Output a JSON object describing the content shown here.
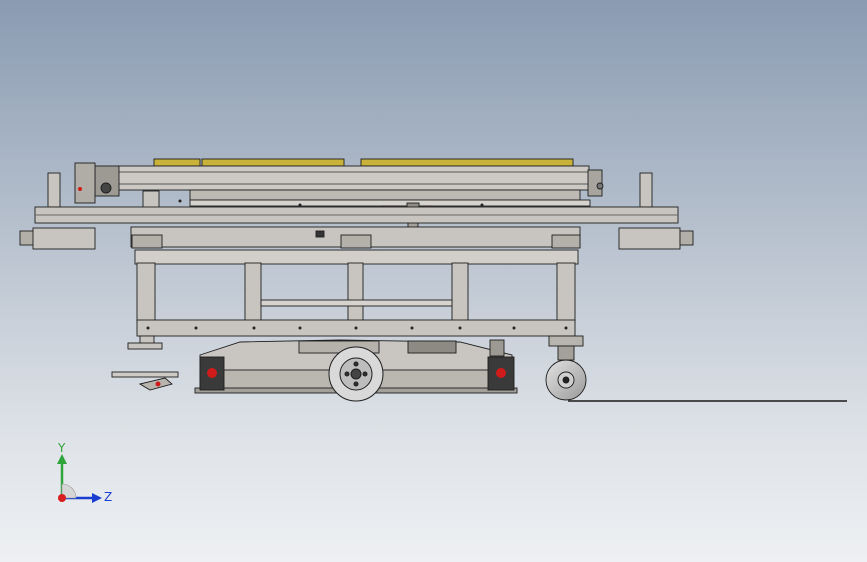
{
  "triad": {
    "y_label": "Y",
    "z_label": "Z",
    "colors": {
      "y_axis": "#2fa43a",
      "z_axis": "#1a3fd0",
      "x_axis": "#d81e1e"
    }
  },
  "colors": {
    "frame_fill": "#c8c5c0",
    "frame_stroke": "#1e1e1e",
    "yellow_pad": "#c9b23a",
    "dark_part": "#3a3a3a",
    "ground_line": "#1a1a1a"
  }
}
